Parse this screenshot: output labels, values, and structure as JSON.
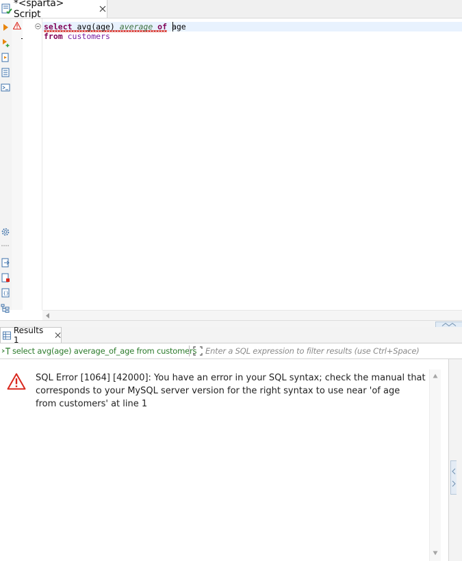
{
  "editor_tab": {
    "label": "*<sparta> Script"
  },
  "editor": {
    "line1": {
      "kw_select": "select",
      "fn": " avg(age)",
      "alias": " average",
      "kw_of": " of",
      "ident": " age"
    },
    "line2": {
      "kw_from": "from",
      "ident": " customers"
    }
  },
  "results": {
    "tab_label": "Results 1",
    "query_text": "select avg(age) average_of_age from customers",
    "filter_placeholder": "Enter a SQL expression to filter results (use Ctrl+Space)",
    "error": {
      "line1": "SQL Error [1064] [42000]: You have an error in your SQL syntax; check the manual that",
      "line2": "corresponds to your MySQL server version for the right syntax to use near 'of age",
      "line3": "from customers' at line 1"
    }
  },
  "colors": {
    "accent_orange": "#e8850c",
    "error_red": "#d9271d",
    "keyword": "#7f0055",
    "query_green": "#2a7a2a"
  }
}
